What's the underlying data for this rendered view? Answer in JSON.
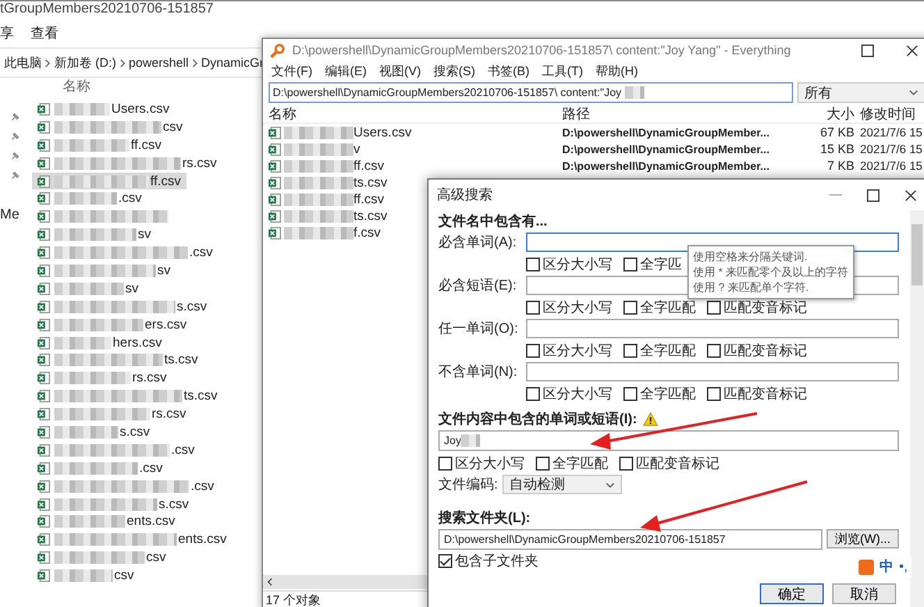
{
  "explorer": {
    "title": "tGroupMembers20210706-151857",
    "ribbon_tabs": [
      "享",
      "查看"
    ],
    "breadcrumb": [
      "此电脑",
      "新加卷 (D:)",
      "powershell",
      "DynamicGr"
    ],
    "nav_items": [
      "Me"
    ],
    "column": "名称",
    "files": [
      {
        "name": "Users.csv",
        "selected": false
      },
      {
        "name": "csv",
        "selected": false
      },
      {
        "name": "ff.csv",
        "selected": false
      },
      {
        "name": "rs.csv",
        "selected": false
      },
      {
        "name": "ff.csv",
        "selected": true
      },
      {
        "name": ".csv",
        "selected": false
      },
      {
        "selected": false
      },
      {
        "name": "sv",
        "selected": false
      },
      {
        "name": ".csv",
        "selected": false
      },
      {
        "name": "sv",
        "selected": false
      },
      {
        "name": "sv",
        "selected": false
      },
      {
        "name": "s.csv",
        "selected": false
      },
      {
        "name": "ers.csv",
        "selected": false
      },
      {
        "name": "hers.csv",
        "selected": false
      },
      {
        "name": "ts.csv",
        "selected": false
      },
      {
        "name": "rs.csv",
        "selected": false
      },
      {
        "name": "ts.csv",
        "selected": false
      },
      {
        "name": "rs.csv",
        "selected": false
      },
      {
        "name": "s.csv",
        "selected": false
      },
      {
        "name": ".csv",
        "selected": false
      },
      {
        "name": ".csv",
        "selected": false
      },
      {
        "name": ".csv",
        "selected": false
      },
      {
        "name": "s.csv",
        "selected": false
      },
      {
        "name": "ents.csv",
        "selected": false
      },
      {
        "name": "ents.csv",
        "selected": false
      },
      {
        "name": "csv",
        "selected": false
      },
      {
        "name": "csv",
        "selected": false
      }
    ]
  },
  "everything": {
    "title": "D:\\powershell\\DynamicGroupMembers20210706-151857\\ content:\"Joy Yang\"  - Everything",
    "menu": [
      "文件(F)",
      "编辑(E)",
      "视图(V)",
      "搜索(S)",
      "书签(B)",
      "工具(T)",
      "帮助(H)"
    ],
    "search": "D:\\powershell\\DynamicGroupMembers20210706-151857\\ content:\"Joy ",
    "filter": "所有",
    "columns": [
      "名称",
      "路径",
      "大小",
      "修改时间"
    ],
    "results": [
      {
        "name": "Users.csv",
        "path": "D:\\powershell\\DynamicGroupMember...",
        "size": "67 KB",
        "date": "2021/7/6 15"
      },
      {
        "name": "v",
        "path": "D:\\powershell\\DynamicGroupMember...",
        "size": "15 KB",
        "date": "2021/7/6 15"
      },
      {
        "name": "ff.csv",
        "path": "D:\\powershell\\DynamicGroupMember...",
        "size": "7 KB",
        "date": "2021/7/6 15"
      },
      {
        "name": "ts.csv"
      },
      {
        "name": "ff.csv"
      },
      {
        "name": "ts.csv"
      },
      {
        "name": "f.csv"
      }
    ],
    "status": "17 个对象"
  },
  "dialog": {
    "title": "高级搜索",
    "name_section": "文件名中包含有...",
    "name_rows": [
      {
        "label": "必含单词(A):",
        "options": [
          {
            "label": "区分大小写",
            "checked": false
          },
          {
            "label": "全字匹",
            "checked": false
          }
        ]
      },
      {
        "label": "必含短语(E):",
        "options": [
          {
            "label": "区分大小写",
            "checked": false
          },
          {
            "label": "全字匹配",
            "checked": false
          },
          {
            "label": "匹配变音标记",
            "checked": false
          }
        ]
      },
      {
        "label": "任一单词(O):",
        "options": [
          {
            "label": "区分大小写",
            "checked": false
          },
          {
            "label": "全字匹配",
            "checked": false
          },
          {
            "label": "匹配变音标记",
            "checked": false
          }
        ]
      },
      {
        "label": "不含单词(N):",
        "options": [
          {
            "label": "区分大小写",
            "checked": false
          },
          {
            "label": "全字匹配",
            "checked": false
          },
          {
            "label": "匹配变音标记",
            "checked": false
          }
        ]
      }
    ],
    "tooltip": [
      "使用空格来分隔关键词.",
      "使用 * 来匹配零个及以上的字符",
      "使用 ? 来匹配单个字符."
    ],
    "content_label": "文件内容中包含的单词或短语(I):",
    "content_value": "Joy",
    "content_options": [
      {
        "label": "区分大小写",
        "checked": false
      },
      {
        "label": "全字匹配",
        "checked": false
      },
      {
        "label": "匹配变音标记",
        "checked": false
      }
    ],
    "encoding_label": "文件编码:",
    "encoding_value": "自动检测",
    "folder_label": "搜索文件夹(L):",
    "folder_value": "D:\\powershell\\DynamicGroupMembers20210706-151857",
    "browse": "浏览(W)...",
    "subfolders": {
      "label": "包含子文件夹",
      "checked": true
    },
    "buttons": [
      "确定",
      "取消"
    ]
  },
  "ime": {
    "language": "中",
    "punct": "•,"
  }
}
